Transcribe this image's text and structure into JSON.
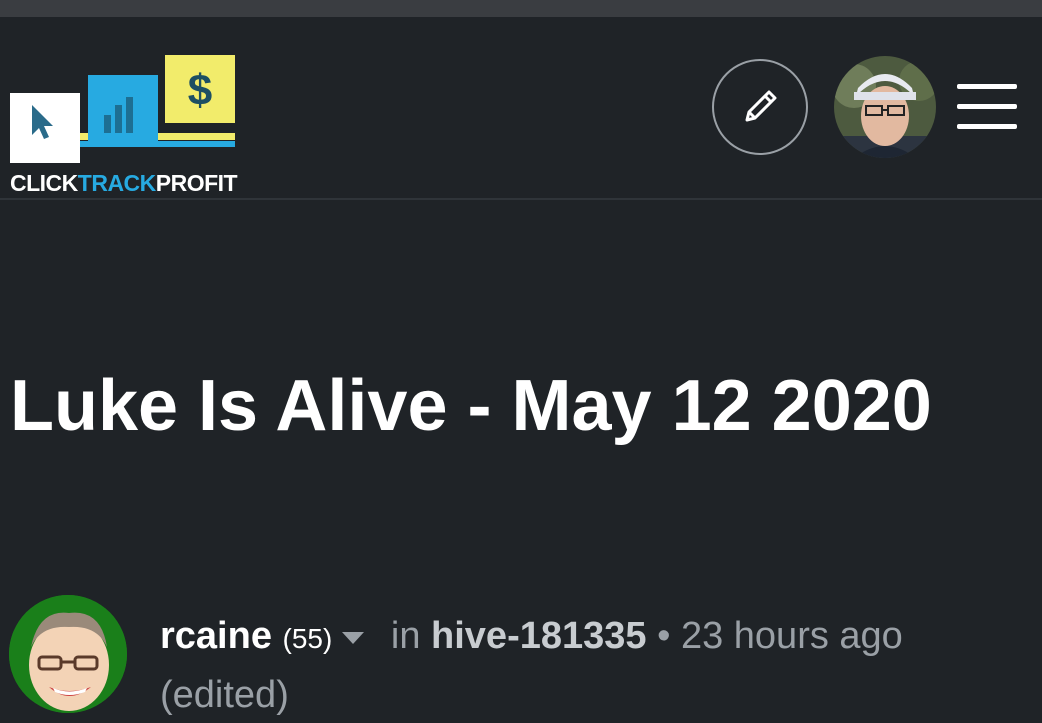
{
  "header": {
    "logo_text_part1": "CLICK",
    "logo_text_part2": "TRACK",
    "logo_text_part3": "PROFIT",
    "logo_dollar": "$"
  },
  "post": {
    "title": "Luke Is Alive - May 12 2020",
    "author": "rcaine",
    "reputation": "(55)",
    "in_label": "in",
    "community": "hive-181335",
    "separator": "•",
    "time": "23 hours ago",
    "edited": "(edited)"
  },
  "colors": {
    "background": "#1f2327",
    "logo_blue": "#27aae1",
    "logo_yellow": "#f2ec6b",
    "author_avatar_ring": "#1a7f1a"
  }
}
